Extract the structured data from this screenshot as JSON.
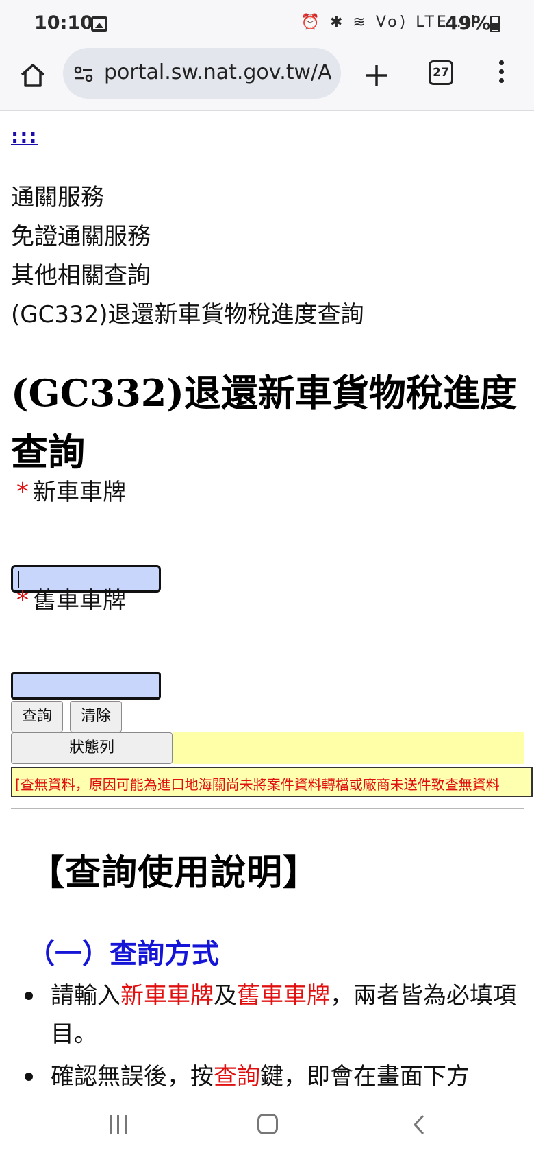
{
  "status_bar": {
    "time": "10:10",
    "icons_text": "⏰ ✱ ≋ Vo) LTE .ıl",
    "battery_percent": "49%",
    "battery_level": 0.49
  },
  "browser": {
    "url": "portal.sw.nat.gov.tw/AP",
    "tab_count": "27"
  },
  "page": {
    "skip_link": ":::",
    "breadcrumb": [
      "通關服務",
      "免證通關服務",
      "其他相關查詢",
      "(GC332)退還新車貨物稅進度查詢"
    ],
    "title": "(GC332)退還新車貨物稅進度查詢",
    "form": {
      "required_mark": "*",
      "new_plate_label": "新車車牌",
      "new_plate_value": "",
      "old_plate_label": "舊車車牌",
      "old_plate_value": "",
      "query_button": "查詢",
      "clear_button": "清除",
      "status_button": "狀態列",
      "message": "[查無資料，原因可能為進口地海關尚未將案件資料轉檔或廠商未送件致查無資料"
    },
    "instructions": {
      "title": "【查詢使用說明】",
      "subtitle": "（一）查詢方式",
      "item1_a": "請輸入",
      "item1_b": "新車車牌",
      "item1_c": "及",
      "item1_d": "舊車車牌",
      "item1_e": "，兩者皆為必填項目。",
      "item2_a": "確認無誤後，按",
      "item2_b": "查詢",
      "item2_c": "鍵，即會在畫面下方"
    }
  }
}
